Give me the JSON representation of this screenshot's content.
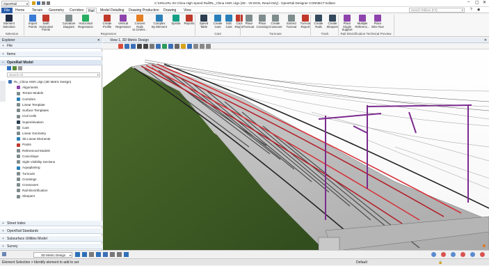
{
  "workflow": "OpenRail Modeling",
  "window_title": "C:\\URLURL-02 China High Speed Rail\\RL_China HSR.i.dgn [3D - V8 DGN, Read-Only] - OpenRail Designer CONNECT Edition",
  "search_placeholder": "Search Ribbon (F4)",
  "tabs": [
    "File",
    "Home",
    "Terrain",
    "Geometry",
    "Corridors",
    "Rail",
    "Model Detailing",
    "Drawing Production",
    "Drawing",
    "View"
  ],
  "ribbon": {
    "buttons": [
      {
        "label": "Element\nSelection",
        "color": "#1f2a44"
      },
      {
        "label": "Import\nPoints",
        "color": "#3a7bd5"
      },
      {
        "label": "Swift\nHorizontal Points",
        "color": "#c0392b"
      },
      {
        "label": "Curvature\nDiagram",
        "color": "#7f8c8d"
      },
      {
        "label": "Horizontal\nRegression",
        "color": "#27ae60"
      },
      {
        "label": "Create\nProfile",
        "color": "#c0392b"
      },
      {
        "label": "Vertical\nRegression",
        "color": "#8e44ad"
      },
      {
        "label": "Convert Rails\nto Center...",
        "color": "#e67e22"
      },
      {
        "label": "Complex\nBy Element",
        "color": "#2980b9"
      },
      {
        "label": "Spirals",
        "color": "#16a085"
      },
      {
        "label": "Reports",
        "color": "#c0392b"
      },
      {
        "label": "Speed\nTable",
        "color": "#2c3e50"
      },
      {
        "label": "Create\nCant",
        "color": "#2980b9"
      },
      {
        "label": "Edit\nCant",
        "color": "#2980b9"
      },
      {
        "label": "Cant\nReport",
        "color": "#c0392b"
      },
      {
        "label": "Place\nTurnout",
        "color": "#7f8c8d"
      },
      {
        "label": "Place\nCrossing",
        "color": "#7f8c8d"
      },
      {
        "label": "Create\nCrossover",
        "color": "#7f8c8d"
      },
      {
        "label": "Extend\nTurnout",
        "color": "#7f8c8d"
      },
      {
        "label": "Turnout\nReport",
        "color": "#c0392b"
      },
      {
        "label": "Create\nRails",
        "color": "#34495e"
      },
      {
        "label": "Create\nSleepers",
        "color": "#34495e"
      },
      {
        "label": "Place Single\nSupport",
        "color": "#8e44ad"
      },
      {
        "label": "Multiple\nReferenc...",
        "color": "#8e44ad"
      },
      {
        "label": "Place\nWire Run",
        "color": "#8e44ad"
      }
    ],
    "groups": [
      "Selection",
      "Regression",
      "Cant",
      "Turnouts",
      "Track",
      "Rail Electrification Technical Preview"
    ]
  },
  "explorer": {
    "title": "Explorer",
    "sections_top": [
      "File",
      "Items",
      "OpenRail Model"
    ],
    "search_placeholder": "Search All",
    "root": "RL_China HSR.i.dgn (3D Metric Design)",
    "items": [
      {
        "label": "Alignments",
        "color": "#8e44ad"
      },
      {
        "label": "Terrain Models",
        "color": "#7f8c8d"
      },
      {
        "label": "Corridors",
        "color": "#2980b9"
      },
      {
        "label": "Linear Template",
        "color": "#7f8c8d"
      },
      {
        "label": "Surface Templates",
        "color": "#7f8c8d"
      },
      {
        "label": "Civil Cells",
        "color": "#7f8c8d"
      },
      {
        "label": "Superelevation",
        "color": "#2c3e50"
      },
      {
        "label": "Cant",
        "color": "#7f8c8d"
      },
      {
        "label": "Linear Geometry",
        "color": "#7f8c8d"
      },
      {
        "label": "3D Linear Elements",
        "color": "#2980b9"
      },
      {
        "label": "Points",
        "color": "#c0392b"
      },
      {
        "label": "Referenced Models",
        "color": "#7f8c8d"
      },
      {
        "label": "ConicSlope",
        "color": "#7f8c8d"
      },
      {
        "label": "Sight Visibility Sections",
        "color": "#7f8c8d"
      },
      {
        "label": "Aquaplaning",
        "color": "#2980b9"
      },
      {
        "label": "Turnouts",
        "color": "#7f8c8d"
      },
      {
        "label": "Crossings",
        "color": "#7f8c8d"
      },
      {
        "label": "Crossovers",
        "color": "#7f8c8d"
      },
      {
        "label": "Rail Electrification",
        "color": "#7f8c8d"
      },
      {
        "label": "Sleepers",
        "color": "#7f8c8d"
      }
    ],
    "sections_bottom": [
      "Sheet Index",
      "OpenRail Standards",
      "Subsurface Utilities Model",
      "Survey"
    ]
  },
  "view": {
    "title": "View 1, 3D Metric Design"
  },
  "bottom": {
    "model": "3D Metric Design"
  },
  "status": {
    "message": "Element Selection > Identify element to add to set",
    "level": "Default"
  }
}
